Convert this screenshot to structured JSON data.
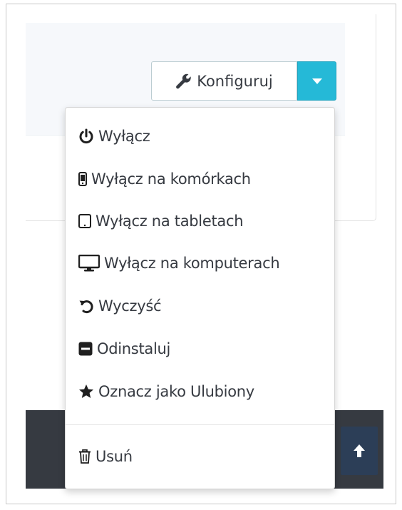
{
  "toolbar": {
    "configure_label": "Konfiguruj"
  },
  "menu": {
    "items": [
      {
        "label": "Wyłącz",
        "icon": "power-icon"
      },
      {
        "label": "Wyłącz na komórkach",
        "icon": "mobile-icon"
      },
      {
        "label": "Wyłącz na tabletach",
        "icon": "tablet-icon"
      },
      {
        "label": "Wyłącz na komputerach",
        "icon": "desktop-icon"
      },
      {
        "label": "Wyczyść",
        "icon": "undo-icon"
      },
      {
        "label": "Odinstaluj",
        "icon": "minus-square-icon"
      },
      {
        "label": "Oznacz jako Ulubiony",
        "icon": "star-icon"
      }
    ],
    "delete": {
      "label": "Usuń",
      "icon": "trash-icon"
    }
  },
  "colors": {
    "accent": "#25b9d7",
    "text": "#363a41",
    "footer": "#363a41",
    "scroll_button": "#2c3e57"
  }
}
